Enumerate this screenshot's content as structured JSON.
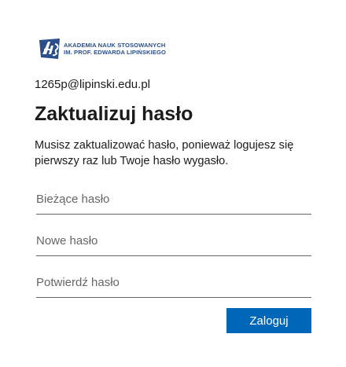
{
  "logo": {
    "mark_icon": "ans-logo-icon",
    "line1": "AKADEMIA NAUK STOSOWANYCH",
    "line2": "IM. PROF. EDWARDA LIPIŃSKIEGO",
    "color": "#2a4f8a"
  },
  "identity": "1265p@lipinski.edu.pl",
  "title": "Zaktualizuj hasło",
  "description": {
    "line1": "Musisz zaktualizować hasło, ponieważ logujesz się",
    "line2": "pierwszy raz lub Twoje hasło wygasło."
  },
  "fields": {
    "current_password": {
      "value": "",
      "placeholder": "Bieżące hasło"
    },
    "new_password": {
      "value": "",
      "placeholder": "Nowe hasło"
    },
    "confirm_password": {
      "value": "",
      "placeholder": "Potwierdź hasło"
    }
  },
  "submit": {
    "label": "Zaloguj",
    "color": "#0067b8"
  }
}
